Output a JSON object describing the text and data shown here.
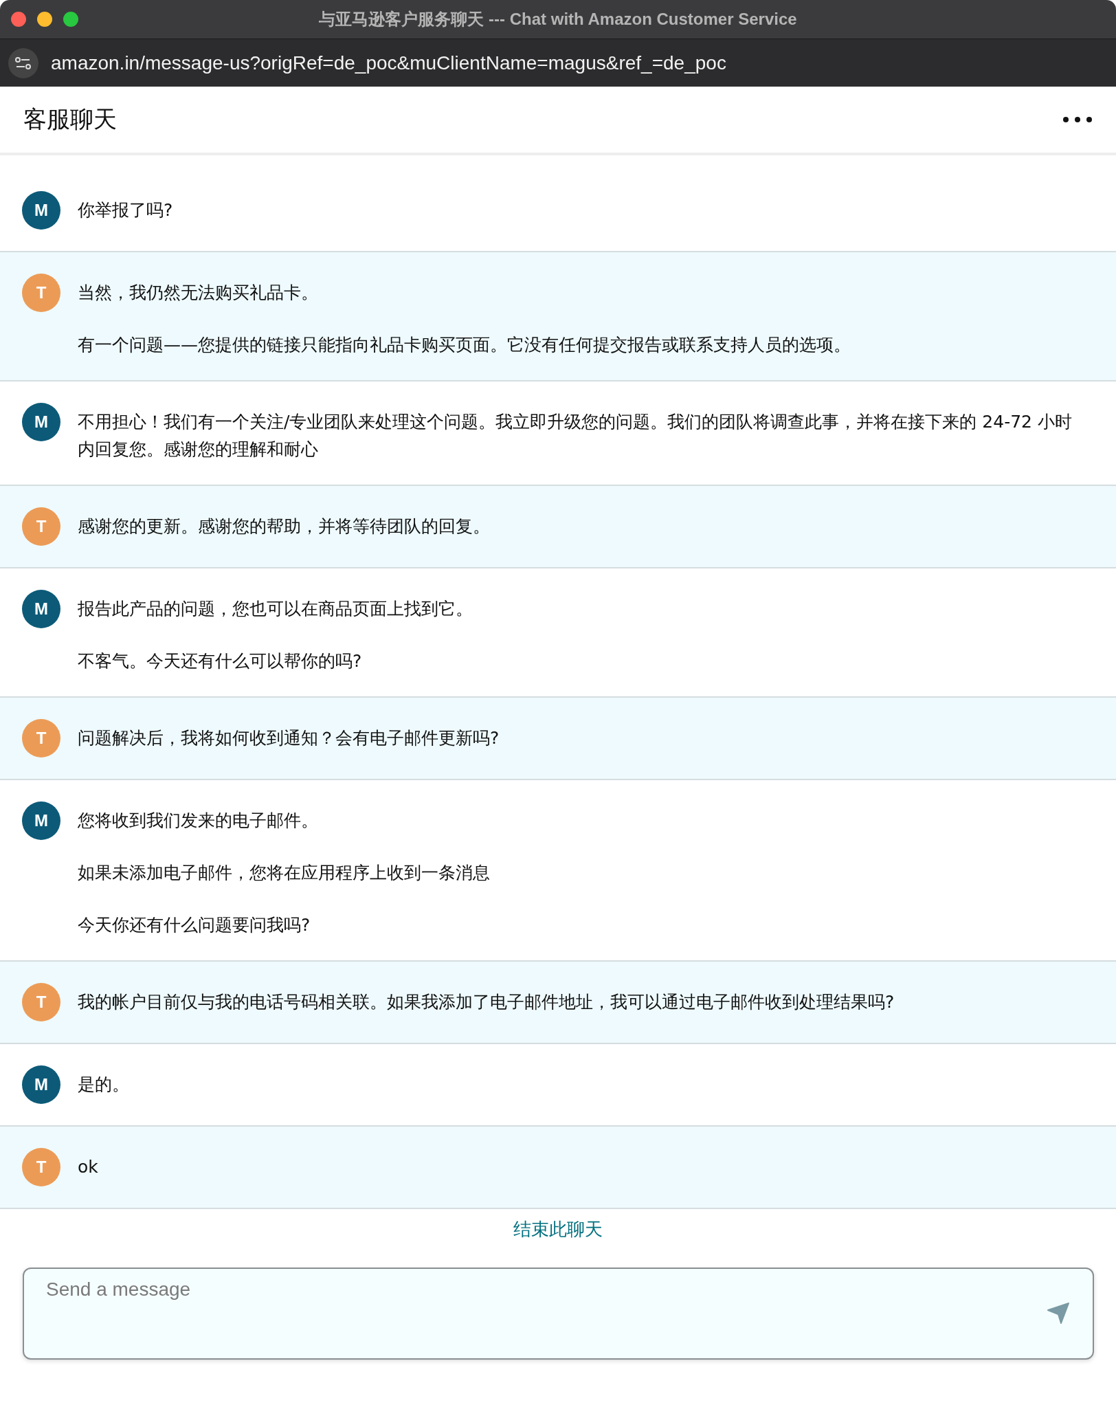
{
  "window": {
    "title": "与亚马逊客户服务聊天 --- Chat with Amazon Customer Service"
  },
  "address_bar": {
    "url": "amazon.in/message-us?origRef=de_poc&muClientName=magus&ref_=de_poc"
  },
  "header": {
    "title": "客服聊天"
  },
  "messages": [
    {
      "kind": "agent",
      "avatar": "M",
      "paragraphs": [
        "你举报了吗?"
      ]
    },
    {
      "kind": "customer",
      "avatar": "T",
      "paragraphs": [
        "当然，我仍然无法购买礼品卡。",
        "有一个问题——您提供的链接只能指向礼品卡购买页面。它没有任何提交报告或联系支持人员的选项。"
      ]
    },
    {
      "kind": "agent",
      "avatar": "M",
      "paragraphs": [
        "不用担心！我们有一个关注/专业团队来处理这个问题。我立即升级您的问题。我们的团队将调查此事，并将在接下来的 24-72 小时内回复您。感谢您的理解和耐心"
      ]
    },
    {
      "kind": "customer",
      "avatar": "T",
      "paragraphs": [
        "感谢您的更新。感谢您的帮助，并将等待团队的回复。"
      ]
    },
    {
      "kind": "agent",
      "avatar": "M",
      "paragraphs": [
        "报告此产品的问题，您也可以在商品页面上找到它。",
        "不客气。今天还有什么可以帮你的吗?"
      ]
    },
    {
      "kind": "customer",
      "avatar": "T",
      "paragraphs": [
        "问题解决后，我将如何收到通知？会有电子邮件更新吗?"
      ]
    },
    {
      "kind": "agent",
      "avatar": "M",
      "paragraphs": [
        "您将收到我们发来的电子邮件。",
        "如果未添加电子邮件，您将在应用程序上收到一条消息",
        "今天你还有什么问题要问我吗?"
      ]
    },
    {
      "kind": "customer",
      "avatar": "T",
      "paragraphs": [
        "我的帐户目前仅与我的电话号码相关联。如果我添加了电子邮件地址，我可以通过电子邮件收到处理结果吗?"
      ]
    },
    {
      "kind": "agent",
      "avatar": "M",
      "paragraphs": [
        "是的。"
      ]
    },
    {
      "kind": "customer",
      "avatar": "T",
      "paragraphs": [
        "ok"
      ]
    }
  ],
  "end_chat_link": "结束此聊天",
  "composer": {
    "placeholder": "Send a message"
  }
}
